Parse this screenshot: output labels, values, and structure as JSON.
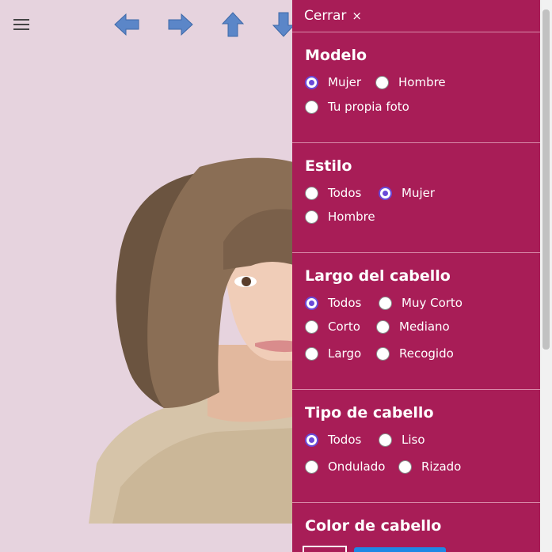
{
  "panel": {
    "close_label": "Cerrar",
    "close_symbol": "×"
  },
  "sections": [
    {
      "title": "Modelo",
      "options": [
        {
          "label": "Mujer",
          "checked": true
        },
        {
          "label": "Hombre",
          "checked": false
        },
        {
          "label": "Tu propia foto",
          "checked": false
        }
      ]
    },
    {
      "title": "Estilo",
      "options": [
        {
          "label": "Todos",
          "checked": false
        },
        {
          "label": "Mujer",
          "checked": true
        },
        {
          "label": "Hombre",
          "checked": false
        }
      ]
    },
    {
      "title": "Largo del cabello",
      "options": [
        {
          "label": "Todos",
          "checked": true
        },
        {
          "label": "Muy Corto",
          "checked": false
        },
        {
          "label": "Corto",
          "checked": false
        },
        {
          "label": "Mediano",
          "checked": false
        },
        {
          "label": "Largo",
          "checked": false
        },
        {
          "label": "Recogido",
          "checked": false
        }
      ]
    },
    {
      "title": "Tipo de cabello",
      "options": [
        {
          "label": "Todos",
          "checked": true
        },
        {
          "label": "Liso",
          "checked": false
        },
        {
          "label": "Ondulado",
          "checked": false
        },
        {
          "label": "Rizado",
          "checked": false
        }
      ]
    },
    {
      "title": "Color de cabello",
      "options": []
    }
  ],
  "icons": {
    "menu": "hamburger-menu-icon",
    "left": "arrow-left-icon",
    "right": "arrow-right-icon",
    "up": "arrow-up-icon",
    "down": "arrow-down-icon"
  },
  "colors": {
    "panel": "#a81d57",
    "background": "#e6d3de",
    "arrow": "#5b86c8",
    "radio_selected": "#6a4ad8",
    "swatch_blue": "#1e88e5"
  }
}
